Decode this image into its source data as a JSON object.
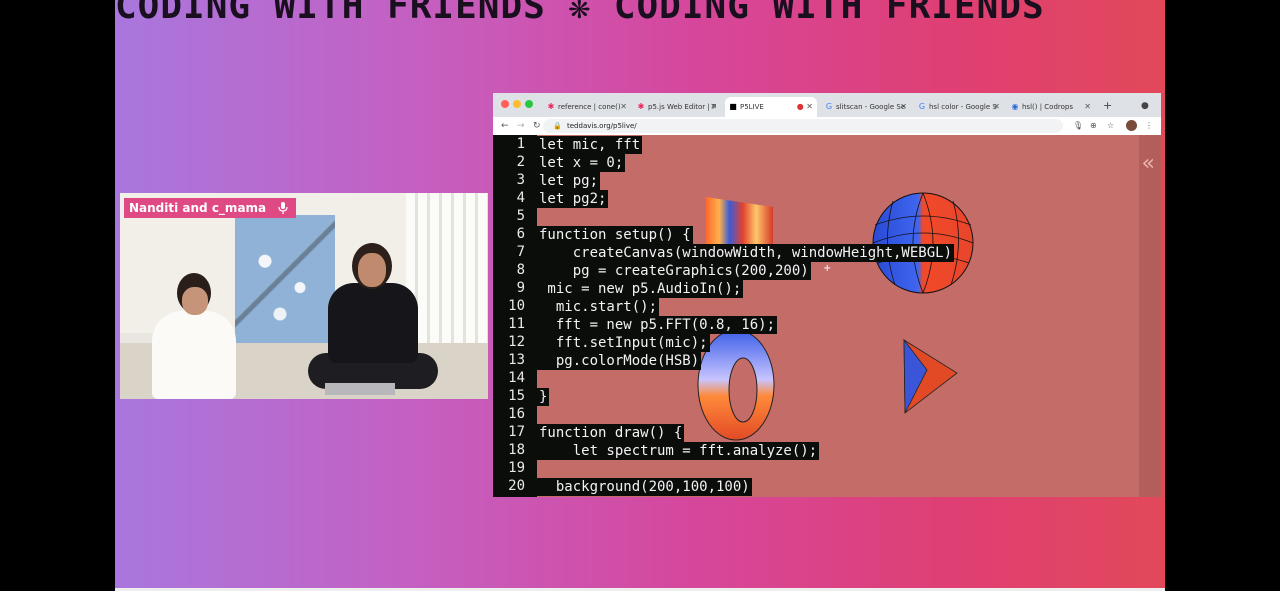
{
  "banner": {
    "text": "CODING WITH FRIENDS ❋ CODING WITH FRIENDS"
  },
  "webcam": {
    "label": "Nanditi and c_mama",
    "mic_icon": "microphone-icon"
  },
  "browser": {
    "tabs": [
      {
        "label": "reference | cone()",
        "favicon": "p5-star-icon"
      },
      {
        "label": "p5.js Web Editor | P",
        "favicon": "p5-star-icon"
      },
      {
        "label": "P5LIVE",
        "favicon": "p5live-icon"
      },
      {
        "label": "slitscan - Google Se",
        "favicon": "google-icon"
      },
      {
        "label": "hsl color - Google S",
        "favicon": "google-icon"
      },
      {
        "label": "hsl() | Codrops",
        "favicon": "codrops-icon"
      }
    ],
    "url": "teddavis.org/p5live/"
  },
  "editor": {
    "lines": [
      {
        "n": "1",
        "code": "let mic, fft"
      },
      {
        "n": "2",
        "code": "let x = 0;"
      },
      {
        "n": "3",
        "code": "let pg;"
      },
      {
        "n": "4",
        "code": "let pg2;"
      },
      {
        "n": "5",
        "code": ""
      },
      {
        "n": "6",
        "code": "function setup() {"
      },
      {
        "n": "7",
        "code": "    createCanvas(windowWidth, windowHeight,WEBGL)"
      },
      {
        "n": "8",
        "code": "    pg = createGraphics(200,200)"
      },
      {
        "n": "9",
        "code": " mic = new p5.AudioIn();"
      },
      {
        "n": "10",
        "code": "  mic.start();"
      },
      {
        "n": "11",
        "code": "  fft = new p5.FFT(0.8, 16);"
      },
      {
        "n": "12",
        "code": "  fft.setInput(mic);"
      },
      {
        "n": "13",
        "code": "  pg.colorMode(HSB)"
      },
      {
        "n": "14",
        "code": ""
      },
      {
        "n": "15",
        "code": "}"
      },
      {
        "n": "16",
        "code": ""
      },
      {
        "n": "17",
        "code": "function draw() {"
      },
      {
        "n": "18",
        "code": "    let spectrum = fft.analyze();"
      },
      {
        "n": "19",
        "code": ""
      },
      {
        "n": "20",
        "code": "  background(200,100,100)"
      }
    ]
  }
}
